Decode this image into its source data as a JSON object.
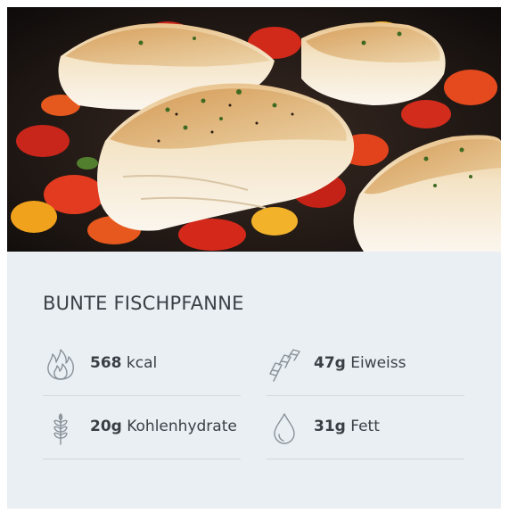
{
  "recipe": {
    "title": "BUNTE FISCHPFANNE"
  },
  "nutrition": [
    {
      "value": "568",
      "unit": "kcal",
      "icon": "flame-icon"
    },
    {
      "value": "47g",
      "unit": "Eiweiss",
      "icon": "protein-icon"
    },
    {
      "value": "20g",
      "unit": "Kohlenhydrate",
      "icon": "wheat-icon"
    },
    {
      "value": "31g",
      "unit": "Fett",
      "icon": "drop-icon"
    }
  ],
  "colors": {
    "card_background": "#e9eff3",
    "text": "#3a3f46",
    "icon_stroke": "#8a929a",
    "divider": "#d2d9de"
  }
}
